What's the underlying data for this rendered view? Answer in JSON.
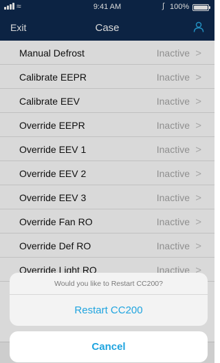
{
  "status_bar": {
    "time": "9:41 AM",
    "battery_pct": "100%"
  },
  "nav": {
    "exit_label": "Exit",
    "title": "Case"
  },
  "rows": [
    {
      "label": "Manual Defrost",
      "status": "Inactive"
    },
    {
      "label": "Calibrate EEPR",
      "status": "Inactive"
    },
    {
      "label": "Calibrate EEV",
      "status": "Inactive"
    },
    {
      "label": "Override EEPR",
      "status": "Inactive"
    },
    {
      "label": "Override EEV 1",
      "status": "Inactive"
    },
    {
      "label": "Override EEV 2",
      "status": "Inactive"
    },
    {
      "label": "Override EEV 3",
      "status": "Inactive"
    },
    {
      "label": "Override Fan RO",
      "status": "Inactive"
    },
    {
      "label": "Override Def RO",
      "status": "Inactive"
    },
    {
      "label": "Override Light RO",
      "status": "Inactive"
    }
  ],
  "action_sheet": {
    "message": "Would you like to Restart CC200?",
    "action_label": "Restart CC200",
    "cancel_label": "Cancel"
  },
  "colors": {
    "header": "#0f2a4f",
    "accent": "#1fa4df",
    "status_text": "#a9a9a9"
  }
}
